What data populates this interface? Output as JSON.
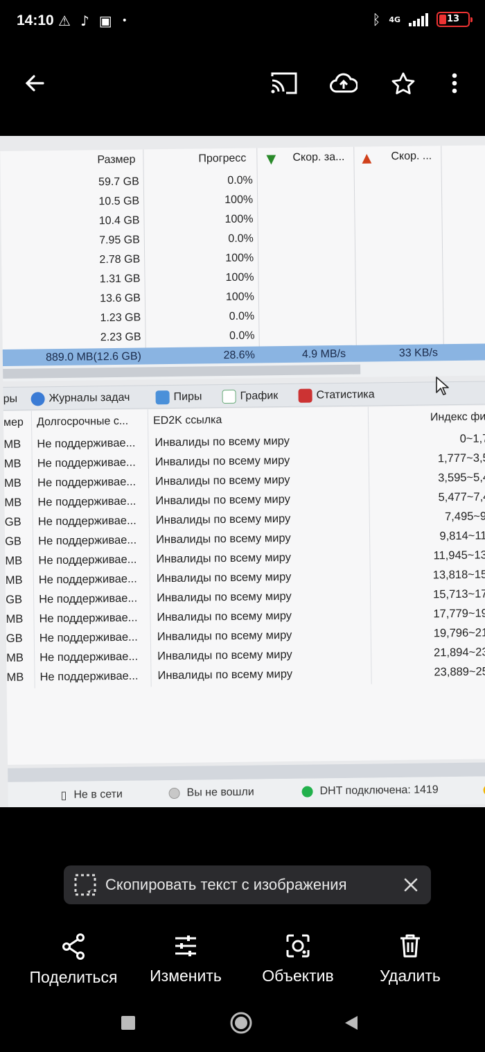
{
  "status_bar": {
    "time": "14:10",
    "network": "4G",
    "battery": "13"
  },
  "torrent_list": {
    "headers": {
      "size": "Размер",
      "progress": "Прогресс",
      "download_speed": "Скор. за...",
      "upload_speed": "Скор. ..."
    },
    "rows": [
      {
        "size": "59.7 GB",
        "progress": "0.0%"
      },
      {
        "size": "10.5 GB",
        "progress": "100%"
      },
      {
        "size": "10.4 GB",
        "progress": "100%"
      },
      {
        "size": "7.95 GB",
        "progress": "0.0%"
      },
      {
        "size": "2.78 GB",
        "progress": "100%"
      },
      {
        "size": "1.31 GB",
        "progress": "100%"
      },
      {
        "size": "13.6 GB",
        "progress": "100%"
      },
      {
        "size": "1.23 GB",
        "progress": "0.0%"
      },
      {
        "size": "2.23 GB",
        "progress": "0.0%"
      }
    ],
    "selected": {
      "size": "889.0 MB(12.6 GB)",
      "progress": "28.6%",
      "download_speed": "4.9 MB/s",
      "upload_speed": "33 KB/s"
    }
  },
  "tabs": {
    "partial": "ры",
    "logs": "Журналы задач",
    "peers": "Пиры",
    "graph": "График",
    "stats": "Статистика"
  },
  "file_list": {
    "headers": {
      "unit_partial": "мер",
      "longterm": "Долгосрочные с...",
      "ed2k": "ED2K ссылка",
      "index": "Индекс фи"
    },
    "rows": [
      {
        "unit": "MB",
        "longterm": "Не поддерживае...",
        "ed2k": "Инвалиды по всему миру",
        "index": "0~1,7"
      },
      {
        "unit": "MB",
        "longterm": "Не поддерживае...",
        "ed2k": "Инвалиды по всему миру",
        "index": "1,777~3,5"
      },
      {
        "unit": "MB",
        "longterm": "Не поддерживае...",
        "ed2k": "Инвалиды по всему миру",
        "index": "3,595~5,4"
      },
      {
        "unit": "MB",
        "longterm": "Не поддерживае...",
        "ed2k": "Инвалиды по всему миру",
        "index": "5,477~7,4"
      },
      {
        "unit": "GB",
        "longterm": "Не поддерживае...",
        "ed2k": "Инвалиды по всему миру",
        "index": "7,495~9,"
      },
      {
        "unit": "GB",
        "longterm": "Не поддерживае...",
        "ed2k": "Инвалиды по всему миру",
        "index": "9,814~11,"
      },
      {
        "unit": "MB",
        "longterm": "Не поддерживае...",
        "ed2k": "Инвалиды по всему миру",
        "index": "11,945~13,"
      },
      {
        "unit": "MB",
        "longterm": "Не поддерживае...",
        "ed2k": "Инвалиды по всему миру",
        "index": "13,818~15,"
      },
      {
        "unit": "GB",
        "longterm": "Не поддерживае...",
        "ed2k": "Инвалиды по всему миру",
        "index": "15,713~17,"
      },
      {
        "unit": "MB",
        "longterm": "Не поддерживае...",
        "ed2k": "Инвалиды по всему миру",
        "index": "17,779~19,"
      },
      {
        "unit": "GB",
        "longterm": "Не поддерживае...",
        "ed2k": "Инвалиды по всему миру",
        "index": "19,796~21,"
      },
      {
        "unit": "MB",
        "longterm": "Не поддерживае...",
        "ed2k": "Инвалиды по всему миру",
        "index": "21,894~23,"
      },
      {
        "unit": "MB",
        "longterm": "Не поддерживае...",
        "ed2k": "Инвалиды по всему миру",
        "index": "23,889~25,"
      }
    ]
  },
  "app_status": {
    "network": "Не в сети",
    "login": "Вы не вошли",
    "dht": "DHT подключена: 1419"
  },
  "copy_chip": {
    "label": "Скопировать текст с изображения"
  },
  "actions": {
    "share": "Поделиться",
    "edit": "Изменить",
    "lens": "Объектив",
    "delete": "Удалить"
  },
  "colors": {
    "selected_row": "#8ab4e2",
    "dht_dot": "#22b14c",
    "battery": "#e33333"
  }
}
